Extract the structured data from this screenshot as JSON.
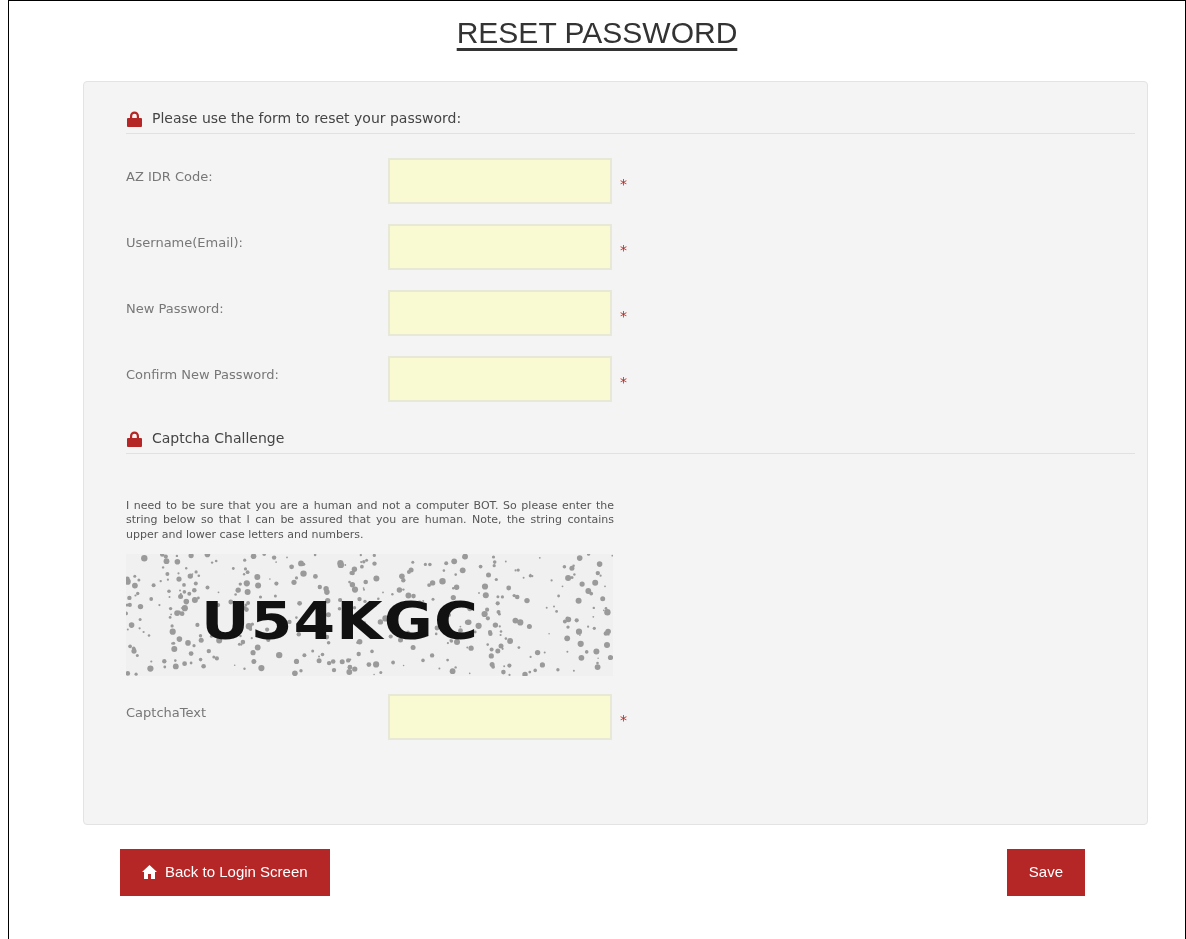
{
  "title": "RESET PASSWORD",
  "form_heading": "Please use the form to reset your password:",
  "fields": [
    {
      "label": "AZ IDR Code:",
      "required_mark": "*"
    },
    {
      "label": "Username(Email):",
      "required_mark": "*"
    },
    {
      "label": "New Password:",
      "required_mark": "*"
    },
    {
      "label": "Confirm New Password:",
      "required_mark": "*"
    }
  ],
  "captcha": {
    "heading": "Captcha Challenge",
    "instructions": "I need to be sure that you are a human and not a computer BOT. So please enter the string below so that I can be assured that you are human. Note, the string contains upper and lower case letters and numbers.",
    "image_text": "U54KGC",
    "field": {
      "label": "CaptchaText",
      "required_mark": "*"
    }
  },
  "buttons": {
    "back": "Back to Login Screen",
    "save": "Save"
  }
}
